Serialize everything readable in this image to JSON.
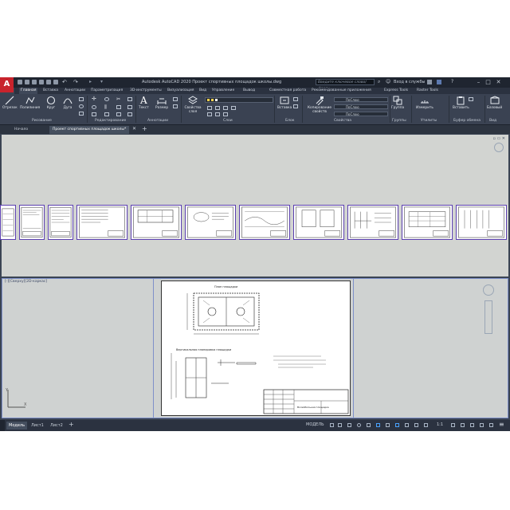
{
  "app": {
    "logo": "A",
    "title": "Autodesk AutoCAD 2020   Проект спортивных площадок школы.dwg",
    "search_placeholder": "Введите ключевое слово/фразу",
    "signin": "Вход в службы"
  },
  "ribbon_tabs": [
    "Главная",
    "Вставка",
    "Аннотации",
    "Параметризация",
    "3D-инструменты",
    "Визуализация",
    "Вид",
    "Управление",
    "Вывод",
    "Совместная работа",
    "Рекомендованные приложения",
    "Express Tools",
    "Raster Tools"
  ],
  "draw_panel": {
    "tools": [
      "Отрезок",
      "Полилиния",
      "Круг",
      "Дуга"
    ],
    "title": "Рисование"
  },
  "modify_panel": {
    "title": "Редактирование"
  },
  "annotation_panel": {
    "tools": [
      "Текст",
      "Размер"
    ],
    "title": "Аннотации"
  },
  "layers_panel": {
    "tool": "Свойства слоя",
    "title": "Слои"
  },
  "block_panel": {
    "tool": "Вставка",
    "title": "Блок"
  },
  "properties_panel": {
    "tool": "Копирование свойств",
    "title": "Свойства",
    "dropdowns": [
      "ПоСлою",
      "ПоСлою",
      "ПоСлою"
    ]
  },
  "groups_panel": {
    "tool": "Группа",
    "title": "Группы"
  },
  "utilities_panel": {
    "tool": "Измерить",
    "title": "Утилиты"
  },
  "clipboard_panel": {
    "tool": "Вставить",
    "title": "Буфер обмена"
  },
  "base_panel": {
    "tool": "Базовый",
    "title": "Вид"
  },
  "file_tabs": [
    "Начало",
    "Проект спортивных площадок школы*"
  ],
  "viewport_label": "[-][Сверху][2D-каркас]",
  "drawing": {
    "plan_title": "План площадки",
    "section_title": "Вертикальная планировка площадки",
    "stamp_text": "Волейбольная площадка"
  },
  "layout_tabs": [
    "Модель",
    "Лист1",
    "Лист2"
  ],
  "status": {
    "model_label": "МОДЕЛЬ",
    "scale": "1:1"
  },
  "colors": {
    "ribbon_bg": "#3a4252",
    "canvas_bg": "#d2d4d1",
    "title_bg": "#1f2530",
    "thumbnail_border": "#5b3fb0"
  }
}
